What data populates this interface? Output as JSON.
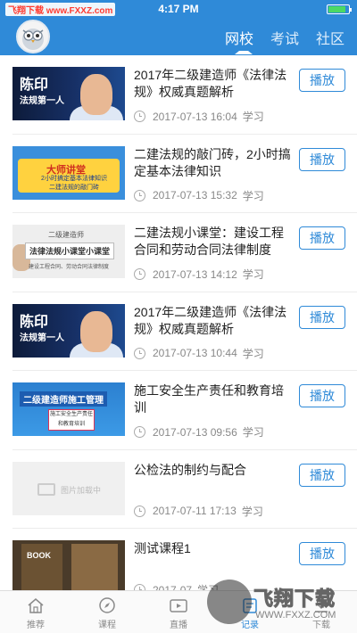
{
  "watermark": {
    "top_left": "飞翔下载 www.FXXZ.com",
    "title": "飞翔下载",
    "url": "WWW.FXXZ.COM"
  },
  "status_bar": {
    "time": "4:17 PM",
    "battery_level": 0.85
  },
  "header": {
    "tabs": [
      {
        "label": "网校",
        "active": true
      },
      {
        "label": "考试",
        "active": false
      },
      {
        "label": "社区",
        "active": false
      }
    ]
  },
  "colors": {
    "brand": "#2f8ad8",
    "text": "#222222",
    "meta": "#888888"
  },
  "courses": [
    {
      "title": "2017年二级建造师《法律法规》权威真题解析",
      "date": "2017-07-13 16:04",
      "tag": "学习",
      "action": "播放",
      "thumb": {
        "type": "teacher",
        "name": "陈印",
        "sub": "法规第一人"
      }
    },
    {
      "title": "二建法规的敲门砖，2小时搞定基本法律知识",
      "date": "2017-07-13 15:32",
      "tag": "学习",
      "action": "播放",
      "thumb": {
        "type": "master",
        "heading": "大师讲堂",
        "line1": "2小时搞定基本法律知识",
        "line2": "二建法规的敲门砖"
      }
    },
    {
      "title": "二建法规小课堂：建设工程合同和劳动合同法律制度",
      "date": "2017-07-13 14:12",
      "tag": "学习",
      "action": "播放",
      "thumb": {
        "type": "class",
        "tag": "二级建造师",
        "heading": "法律法规小课堂小课堂",
        "line": "建设工程合同、劳动合同法律制度"
      }
    },
    {
      "title": "2017年二级建造师《法律法规》权威真题解析",
      "date": "2017-07-13 10:44",
      "tag": "学习",
      "action": "播放",
      "thumb": {
        "type": "teacher",
        "name": "陈印",
        "sub": "法规第一人"
      }
    },
    {
      "title": "施工安全生产责任和教育培训",
      "date": "2017-07-13 09:56",
      "tag": "学习",
      "action": "播放",
      "thumb": {
        "type": "safety",
        "heading": "二级建造师施工管理",
        "box": "施工安全生产责任和教育培训"
      }
    },
    {
      "title": "公检法的制约与配合",
      "date": "2017-07-11 17:13",
      "tag": "学习",
      "action": "播放",
      "thumb": {
        "type": "placeholder",
        "text": "图片加载中"
      }
    },
    {
      "title": "测试课程1",
      "date": "2017-07",
      "tag": "学习",
      "action": "播放",
      "thumb": {
        "type": "book",
        "text": "BOOK"
      }
    }
  ],
  "tabbar": [
    {
      "label": "推荐",
      "icon": "home-icon",
      "active": false
    },
    {
      "label": "课程",
      "icon": "compass-icon",
      "active": false
    },
    {
      "label": "直播",
      "icon": "video-icon",
      "active": false
    },
    {
      "label": "记录",
      "icon": "record-icon",
      "active": true
    },
    {
      "label": "下载",
      "icon": "download-icon",
      "active": false
    }
  ]
}
